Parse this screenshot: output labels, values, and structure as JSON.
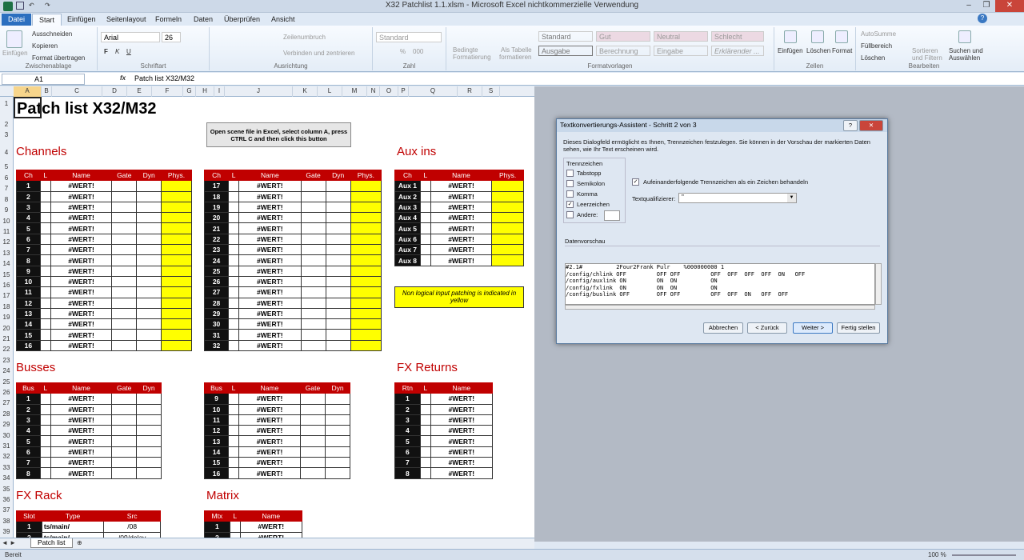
{
  "window": {
    "title": "X32 Patchlist 1.1.xlsm  -  Microsoft Excel nichtkommerzielle Verwendung"
  },
  "tabs": [
    "Datei",
    "Start",
    "Einfügen",
    "Seitenlayout",
    "Formeln",
    "Daten",
    "Überprüfen",
    "Ansicht"
  ],
  "ribbon": {
    "clipboard": {
      "paste": "Einfügen",
      "cut": "Ausschneiden",
      "copy": "Kopieren",
      "format_painter": "Format übertragen",
      "label": "Zwischenablage"
    },
    "font": {
      "name": "Arial",
      "size": "26",
      "label": "Schriftart",
      "bold": "F",
      "italic": "K",
      "underline": "U"
    },
    "alignment": {
      "wrap": "Zeilenumbruch",
      "merge": "Verbinden und zentrieren",
      "label": "Ausrichtung"
    },
    "number": {
      "format": "Standard",
      "pct": "%",
      "thousands": "000",
      "label": "Zahl"
    },
    "styles": {
      "cond_line1": "Bedingte",
      "cond_line2": "Formatierung",
      "table_line1": "Als Tabelle",
      "table_line2": "formatieren",
      "cells": [
        "Standard",
        "Gut",
        "Neutral",
        "Schlecht",
        "Ausgabe",
        "Berechnung",
        "Eingabe",
        "Erklärender ..."
      ],
      "label": "Formatvorlagen"
    },
    "cells": {
      "insert": "Einfügen",
      "delete": "Löschen",
      "format": "Format",
      "label": "Zellen"
    },
    "editing": {
      "autosum": "AutoSumme",
      "fill": "Füllbereich",
      "clear": "Löschen",
      "sort_line1": "Sortieren",
      "sort_line2": "und Filtern",
      "find_line1": "Suchen und",
      "find_line2": "Auswählen",
      "label": "Bearbeiten"
    }
  },
  "formula_bar": {
    "cell": "A1",
    "fx": "fx",
    "content": "Patch list X32/M32"
  },
  "columns": [
    "A",
    "B",
    "C",
    "D",
    "E",
    "F",
    "G",
    "H",
    "I",
    "J",
    "K",
    "L",
    "M",
    "N",
    "O",
    "P",
    "Q",
    "R",
    "S"
  ],
  "rows": [
    "1",
    "2",
    "3",
    "4",
    "5",
    "6",
    "7",
    "8",
    "9",
    "10",
    "11",
    "12",
    "13",
    "14",
    "15",
    "16",
    "17",
    "18",
    "19",
    "20",
    "21",
    "22",
    "23",
    "24",
    "25",
    "26",
    "27",
    "28",
    "29",
    "30",
    "31",
    "32",
    "33",
    "34",
    "35",
    "36",
    "37",
    "38",
    "39",
    "40"
  ],
  "sheet": {
    "title": "Patch list X32/M32",
    "macro_button": "Open scene file in Excel, select column A, press CTRL C and then click this button",
    "sections": {
      "channels": "Channels",
      "aux_ins": "Aux ins",
      "busses": "Busses",
      "fx_returns": "FX Returns",
      "fx_rack": "FX Rack",
      "matrix": "Matrix"
    },
    "note": "Non logical input patching is indicated in yellow",
    "err": "#WERT!",
    "hdr_ch": [
      "Ch",
      "L",
      "Name",
      "Gate",
      "Dyn",
      "Phys."
    ],
    "hdr_aux": [
      "Ch",
      "L",
      "Name",
      "Phys."
    ],
    "hdr_bus": [
      "Bus",
      "L",
      "Name",
      "Gate",
      "Dyn"
    ],
    "hdr_rtn": [
      "Rtn",
      "L",
      "Name"
    ],
    "hdr_fx": [
      "Slot",
      "Type",
      "Src"
    ],
    "hdr_mtx": [
      "Mtx",
      "L",
      "Name"
    ],
    "ch_a": [
      "1",
      "2",
      "3",
      "4",
      "5",
      "6",
      "7",
      "8",
      "9",
      "10",
      "11",
      "12",
      "13",
      "14",
      "15",
      "16"
    ],
    "ch_b": [
      "17",
      "18",
      "19",
      "20",
      "21",
      "22",
      "23",
      "24",
      "25",
      "26",
      "27",
      "28",
      "29",
      "30",
      "31",
      "32"
    ],
    "aux": [
      "Aux 1",
      "Aux 2",
      "Aux 3",
      "Aux 4",
      "Aux 5",
      "Aux 6",
      "Aux 7",
      "Aux 8"
    ],
    "bus_a": [
      "1",
      "2",
      "3",
      "4",
      "5",
      "6",
      "7",
      "8"
    ],
    "bus_b": [
      "9",
      "10",
      "11",
      "12",
      "13",
      "14",
      "15",
      "16"
    ],
    "rtn": [
      "1",
      "2",
      "3",
      "4",
      "5",
      "6",
      "7",
      "8"
    ],
    "fx": [
      {
        "slot": "1",
        "type": "ts/main/",
        "src": "/08"
      },
      {
        "slot": "2",
        "type": "ts/main/",
        "src": "/09/delay"
      }
    ],
    "mtx": [
      "1",
      "2"
    ]
  },
  "sheet_tab": "Patch list",
  "status": {
    "ready": "Bereit",
    "zoom": "100 %"
  },
  "dialog": {
    "title": "Textkonvertierungs-Assistent - Schritt 2 von 3",
    "help": "?",
    "intro": "Dieses Dialogfeld ermöglicht es Ihnen, Trennzeichen festzulegen. Sie können in der Vorschau der markierten Daten sehen, wie Ihr Text erscheinen wird.",
    "delims_label": "Trennzeichen",
    "delims": [
      {
        "label": "Tabstopp",
        "checked": false
      },
      {
        "label": "Semikolon",
        "checked": false
      },
      {
        "label": "Komma",
        "checked": false
      },
      {
        "label": "Leerzeichen",
        "checked": true
      },
      {
        "label": "Andere:",
        "checked": false
      }
    ],
    "consecutive": "Aufeinanderfolgende Trennzeichen als ein Zeichen behandeln",
    "qualifier_label": "Textqualifizierer:",
    "qualifier": "\"",
    "preview_label": "Datenvorschau",
    "preview_rows": [
      "#2.1#          2Four2Frank Pulr    %000000000 1",
      "/config/chlink OFF         OFF OFF         OFF  OFF  OFF  OFF  ON   OFF",
      "/config/auxlink ON         ON  ON          ON",
      "/config/fxlink  ON         ON  ON          ON",
      "/config/buslink OFF        OFF OFF         OFF  OFF  ON   OFF  OFF"
    ],
    "buttons": {
      "cancel": "Abbrechen",
      "back": "< Zurück",
      "next": "Weiter >",
      "finish": "Fertig stellen"
    }
  }
}
